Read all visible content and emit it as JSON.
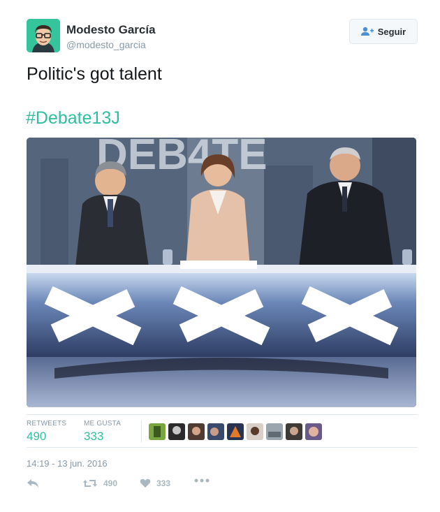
{
  "user": {
    "name": "Modesto García",
    "handle": "@modesto_garcia",
    "avatar_icon": "avatar-glasses-man"
  },
  "follow_button": {
    "label": "Seguir",
    "icon": "follow-person-icon"
  },
  "tweet": {
    "text": "Politic's got talent",
    "hashtag": "#Debate13J"
  },
  "media": {
    "icon": "debate-photo-with-got-talent-x-desk",
    "screen_text": "DEB4TE"
  },
  "stats": {
    "retweets_label": "RETWEETS",
    "retweets_value": "490",
    "likes_label": "ME GUSTA",
    "likes_value": "333"
  },
  "timestamp": "14:19 - 13 jun. 2016",
  "actions": {
    "reply_icon": "reply-icon",
    "retweet_count": "490",
    "like_count": "333",
    "more_icon": "more-icon"
  },
  "colors": {
    "accent": "#2fbfa0",
    "muted": "#8899a6",
    "border": "#e1e8ed"
  }
}
